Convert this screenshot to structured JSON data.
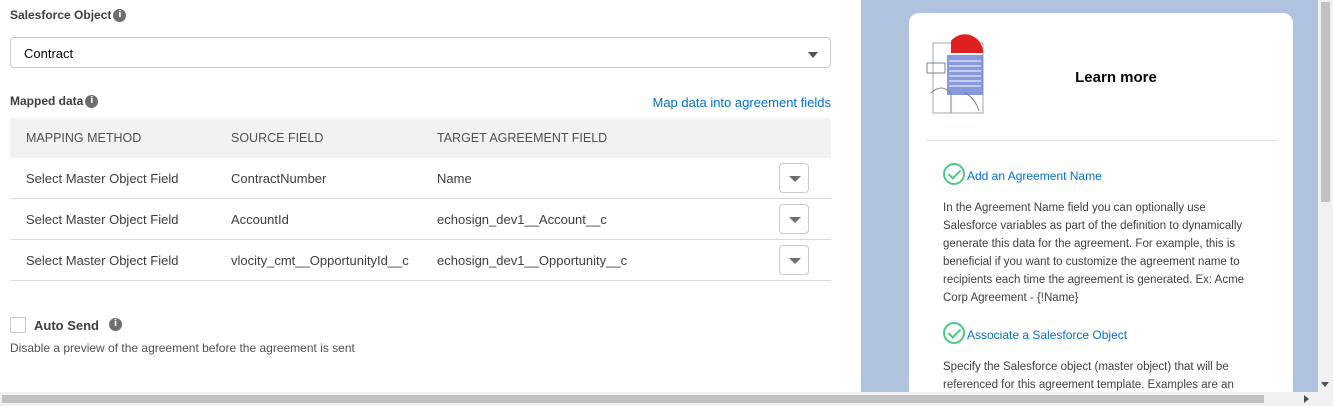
{
  "salesforce_object": {
    "label": "Salesforce Object",
    "info_icon": "i",
    "selected_value": "Contract"
  },
  "mapped_data": {
    "label": "Mapped data",
    "info_icon": "i",
    "link": "Map data into agreement fields",
    "columns": [
      "MAPPING METHOD",
      "SOURCE FIELD",
      "TARGET AGREEMENT FIELD"
    ],
    "rows": [
      {
        "method": "Select Master Object Field",
        "source": "ContractNumber",
        "target": "Name"
      },
      {
        "method": "Select Master Object Field",
        "source": "AccountId",
        "target": "echosign_dev1__Account__c"
      },
      {
        "method": "Select Master Object Field",
        "source": "vlocity_cmt__OpportunityId__c",
        "target": "echosign_dev1__Opportunity__c"
      }
    ]
  },
  "auto_send": {
    "label": "Auto Send",
    "info_icon": "i",
    "checked": false,
    "description": "Disable a preview of the agreement before the agreement is sent"
  },
  "learn_more": {
    "title": "Learn more",
    "steps": [
      {
        "title": "Add an Agreement Name",
        "text": "In the Agreement Name field you can optionally use Salesforce variables as part of the definition to dynamically generate this data for the agreement. For example, this is beneficial if you want to customize the agreement name to recipients each time the agreement is generated. Ex: Acme Corp Agreement - {!Name}"
      },
      {
        "title": "Associate a Salesforce Object",
        "text": "Specify the Salesforce object (master object) that will be referenced for this agreement template. Examples are an"
      }
    ]
  },
  "colors": {
    "link": "#0070d2",
    "panel_bg": "#b0c4df",
    "check": "#4bca81"
  }
}
